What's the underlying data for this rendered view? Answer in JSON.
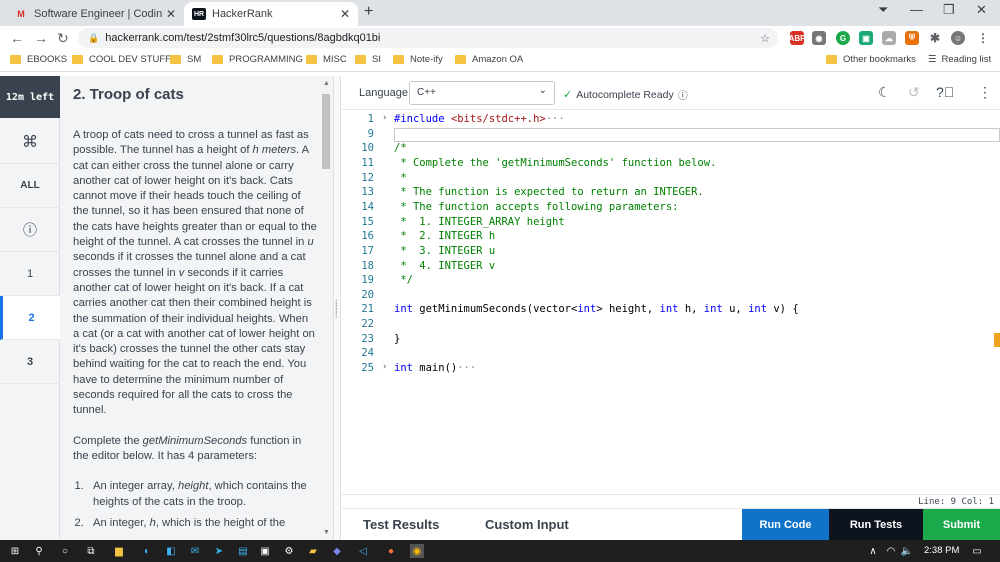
{
  "browser": {
    "tabs": [
      {
        "title": "Software Engineer | Coding Test |",
        "favicon": "gmail-icon"
      },
      {
        "title": "HackerRank",
        "favicon": "hackerrank-icon"
      }
    ],
    "url": "hackerrank.com/test/2stmf30lrc5/questions/8agbdkq01bi",
    "bookmarks": [
      "EBOOKS",
      "COOL DEV STUFF",
      "SM",
      "PROGRAMMING",
      "MISC",
      "SI",
      "Note-ify",
      "Amazon OA"
    ],
    "other_bookmarks": "Other bookmarks",
    "reading_list": "Reading list"
  },
  "rail": {
    "timer": "12m left",
    "items": [
      "⌘",
      "ALL",
      "ⓘ",
      "1",
      "2",
      "3"
    ],
    "active_index": 4
  },
  "problem": {
    "title": "2. Troop of cats",
    "paragraphs": [
      "A troop of cats need to cross a tunnel as fast as possible. The tunnel has a height of h meters. A cat can either cross the tunnel alone or carry another cat of lower height on it's back. Cats cannot move if their heads touch the ceiling of the tunnel, so it has been ensured that none of the cats have heights greater than or equal to the height of the tunnel. A cat crosses the tunnel in u seconds if it crosses the tunnel alone and a cat crosses the tunnel in v seconds if it carries another cat of lower height on it's back. If a cat carries another cat then their combined height is the summation of their individual heights. When a cat (or a cat with another cat of lower height on it's back) crosses the tunnel the other cats stay behind waiting for the cat to reach the end. You have to determine the minimum number of seconds required for all the cats to cross the tunnel.",
      "Complete the getMinimumSeconds function in the editor below. It has 4 parameters:"
    ],
    "list": [
      "An integer array, height, which contains the heights of the cats in the troop.",
      "An integer, h, which is the height of the"
    ]
  },
  "editor": {
    "language_label": "Language",
    "language": "C++",
    "autocomplete": "Autocomplete Ready",
    "status": "Line: 9 Col: 1",
    "lines": [
      {
        "n": "1",
        "fold": "›",
        "text": "#include <bits/stdc++.h>···",
        "cls": "pp"
      },
      {
        "n": "9",
        "fold": "",
        "text": "",
        "cls": ""
      },
      {
        "n": "10",
        "fold": "",
        "text": "/*",
        "cls": "cm"
      },
      {
        "n": "11",
        "fold": "",
        "text": " * Complete the 'getMinimumSeconds' function below.",
        "cls": "cm"
      },
      {
        "n": "12",
        "fold": "",
        "text": " *",
        "cls": "cm"
      },
      {
        "n": "13",
        "fold": "",
        "text": " * The function is expected to return an INTEGER.",
        "cls": "cm"
      },
      {
        "n": "14",
        "fold": "",
        "text": " * The function accepts following parameters:",
        "cls": "cm"
      },
      {
        "n": "15",
        "fold": "",
        "text": " *  1. INTEGER_ARRAY height",
        "cls": "cm"
      },
      {
        "n": "16",
        "fold": "",
        "text": " *  2. INTEGER h",
        "cls": "cm"
      },
      {
        "n": "17",
        "fold": "",
        "text": " *  3. INTEGER u",
        "cls": "cm"
      },
      {
        "n": "18",
        "fold": "",
        "text": " *  4. INTEGER v",
        "cls": "cm"
      },
      {
        "n": "19",
        "fold": "",
        "text": " */",
        "cls": "cm"
      },
      {
        "n": "20",
        "fold": "",
        "text": "",
        "cls": ""
      },
      {
        "n": "21",
        "fold": "",
        "text": "int getMinimumSeconds(vector<int> height, int h, int u, int v) {",
        "cls": "code"
      },
      {
        "n": "22",
        "fold": "",
        "text": "",
        "cls": ""
      },
      {
        "n": "23",
        "fold": "",
        "text": "}",
        "cls": ""
      },
      {
        "n": "24",
        "fold": "",
        "text": "",
        "cls": ""
      },
      {
        "n": "25",
        "fold": "›",
        "text": "int main()···",
        "cls": "main"
      }
    ]
  },
  "bottom": {
    "test_results": "Test Results",
    "custom_input": "Custom Input",
    "run_code": "Run Code",
    "run_tests": "Run Tests",
    "submit": "Submit"
  },
  "taskbar": {
    "time": "2:38 PM"
  }
}
